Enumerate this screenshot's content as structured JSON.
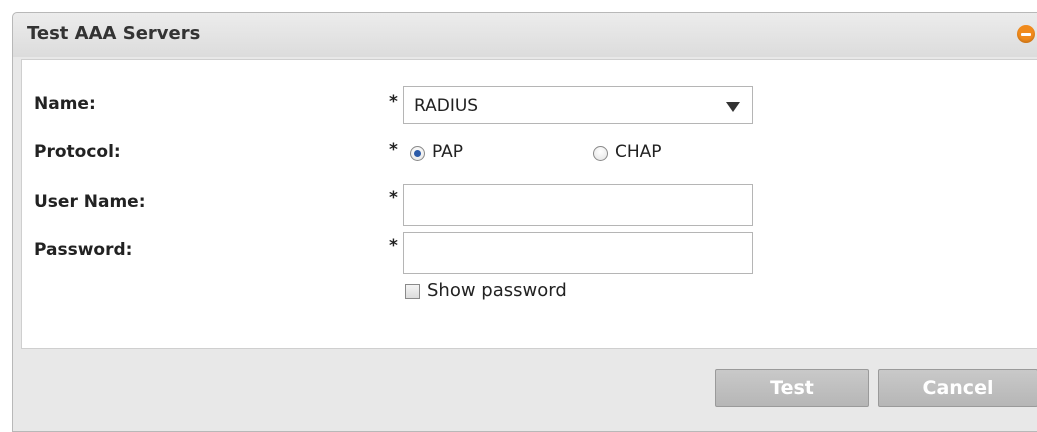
{
  "window": {
    "title": "Test AAA Servers"
  },
  "form": {
    "name": {
      "label": "Name:",
      "required": "*",
      "selected": "RADIUS"
    },
    "protocol": {
      "label": "Protocol:",
      "required": "*",
      "options": [
        {
          "label": "PAP",
          "checked": true
        },
        {
          "label": "CHAP",
          "checked": false
        }
      ]
    },
    "user_name": {
      "label": "User Name:",
      "required": "*",
      "value": ""
    },
    "password": {
      "label": "Password:",
      "required": "*",
      "value": ""
    },
    "show_password": {
      "label": "Show password",
      "checked": false
    }
  },
  "buttons": {
    "test": "Test",
    "cancel": "Cancel"
  },
  "colors": {
    "accent_collapse": "#f08a1c",
    "radio_selected": "#2b5aa8",
    "button_disabled": "#bcbcbc"
  }
}
